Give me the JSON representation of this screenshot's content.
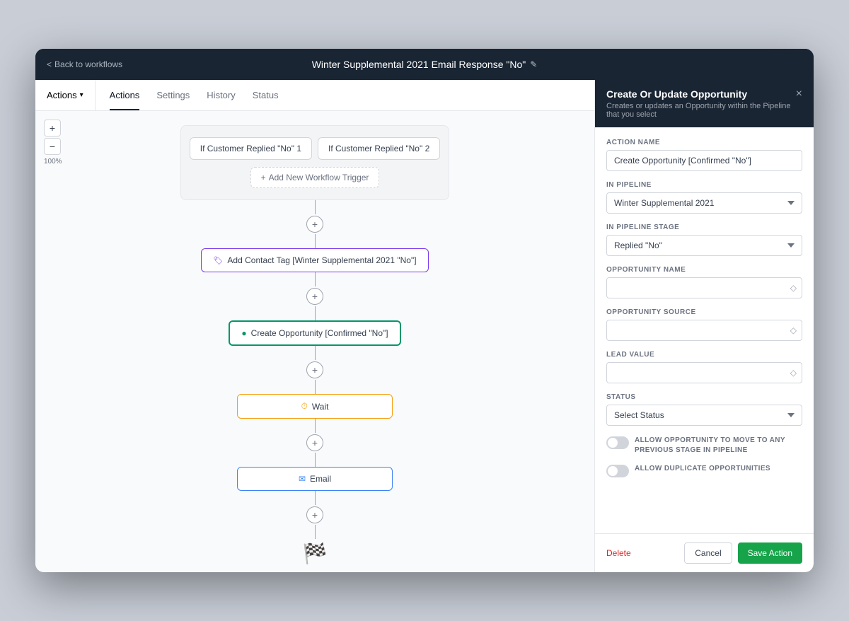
{
  "topbar": {
    "back_label": "Back to workflows",
    "title": "Winter Supplemental 2021 Email Response \"No\"",
    "edit_icon": "✎"
  },
  "tabs": {
    "items": [
      "Actions",
      "Settings",
      "History",
      "Status"
    ],
    "active": "Actions"
  },
  "actions_dropdown": {
    "label": "Actions",
    "chevron": "▾"
  },
  "zoom": {
    "plus": "+",
    "minus": "−",
    "level": "100%"
  },
  "workflow": {
    "trigger1": "If Customer Replied \"No\" 1",
    "trigger2": "If Customer Replied \"No\" 2",
    "add_trigger": "Add New Workflow Trigger",
    "node_tag": "Add Contact Tag [Winter Supplemental 2021 \"No\"]",
    "node_opportunity": "Create Opportunity [Confirmed \"No\"]",
    "node_wait": "Wait",
    "node_email": "Email"
  },
  "right_panel": {
    "title": "Create Or Update Opportunity",
    "subtitle": "Creates or updates an Opportunity within the Pipeline that you select",
    "close_icon": "×",
    "fields": {
      "action_name_label": "ACTION NAME",
      "action_name_value": "Create Opportunity [Confirmed \"No\"]",
      "in_pipeline_label": "IN PIPELINE",
      "in_pipeline_value": "Winter Supplemental 2021",
      "in_pipeline_stage_label": "IN PIPELINE STAGE",
      "in_pipeline_stage_value": "Replied \"No\"",
      "opportunity_name_label": "OPPORTUNITY NAME",
      "opportunity_name_placeholder": "",
      "opportunity_source_label": "OPPORTUNITY SOURCE",
      "opportunity_source_placeholder": "",
      "lead_value_label": "LEAD VALUE",
      "lead_value_placeholder": "",
      "status_label": "STATUS",
      "status_placeholder": "Select Status"
    },
    "toggles": {
      "toggle1_label": "ALLOW OPPORTUNITY TO MOVE TO ANY PREVIOUS STAGE IN PIPELINE",
      "toggle2_label": "ALLOW DUPLICATE OPPORTUNITIES"
    },
    "footer": {
      "delete_label": "Delete",
      "cancel_label": "Cancel",
      "save_label": "Save Action"
    }
  }
}
